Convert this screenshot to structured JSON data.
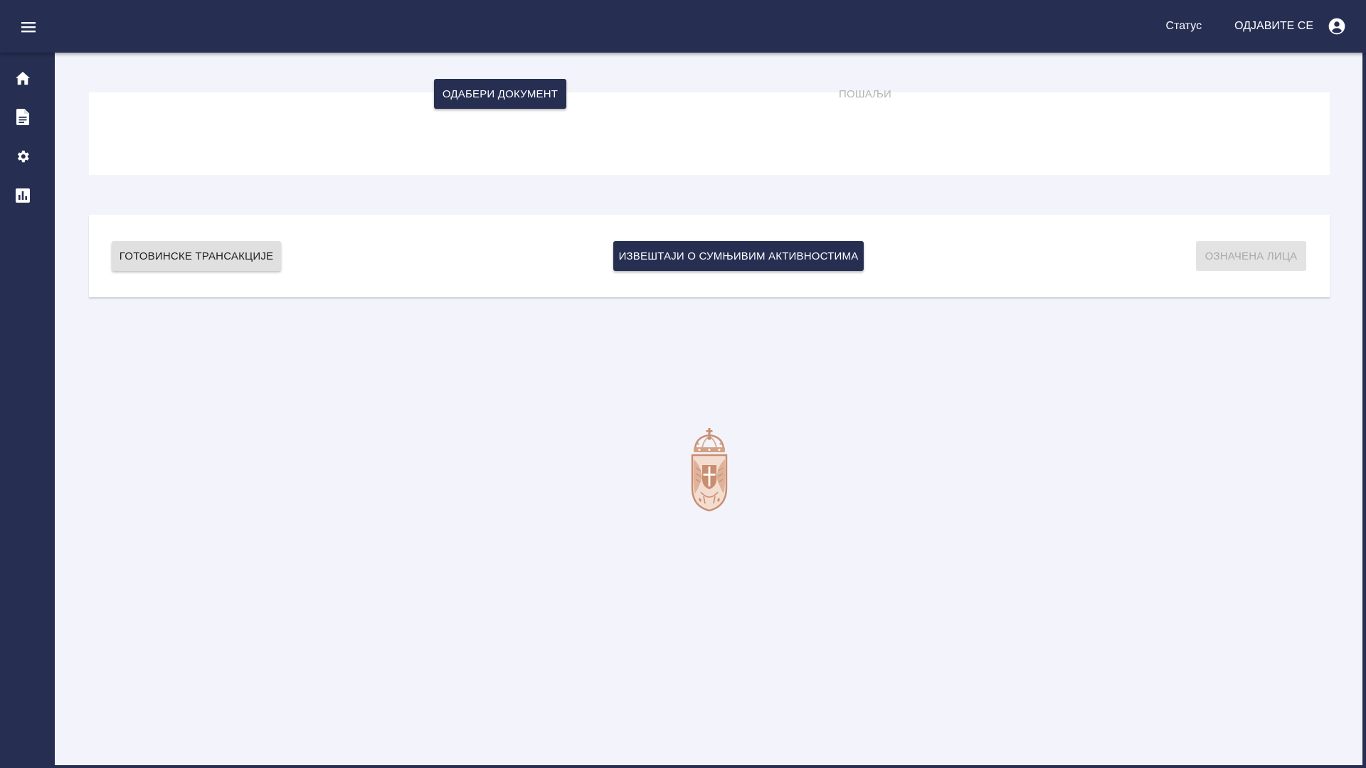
{
  "topbar": {
    "status_label": "Статус",
    "logout_label": "ОДЈАВИТЕ СЕ",
    "menu_icon": "menu-icon",
    "account_icon": "account-circle-icon"
  },
  "sidebar": {
    "items": [
      {
        "icon": "home-icon"
      },
      {
        "icon": "document-icon"
      },
      {
        "icon": "gear-icon"
      },
      {
        "icon": "bar-chart-icon"
      }
    ]
  },
  "upload_card": {
    "select_document_label": "ОДАБЕРИ ДОКУМЕНТ",
    "send_label": "ПОШАЉИ"
  },
  "report_tabs": {
    "cash_transactions_label": "ГОТОВИНСКЕ ТРАНСАКЦИЈЕ",
    "suspicious_reports_label": "ИЗВЕШТАЈИ О СУМЊИВИМ АКТИВНОСТИМА",
    "designated_persons_label": "ОЗНАЧЕНА ЛИЦА"
  },
  "colors": {
    "brand_navy": "#262f52",
    "content_background": "#f3f4fb",
    "card_background": "#ffffff",
    "crest_tint": "#c98d70"
  },
  "emblem": {
    "icon": "coat-of-arms-icon"
  }
}
